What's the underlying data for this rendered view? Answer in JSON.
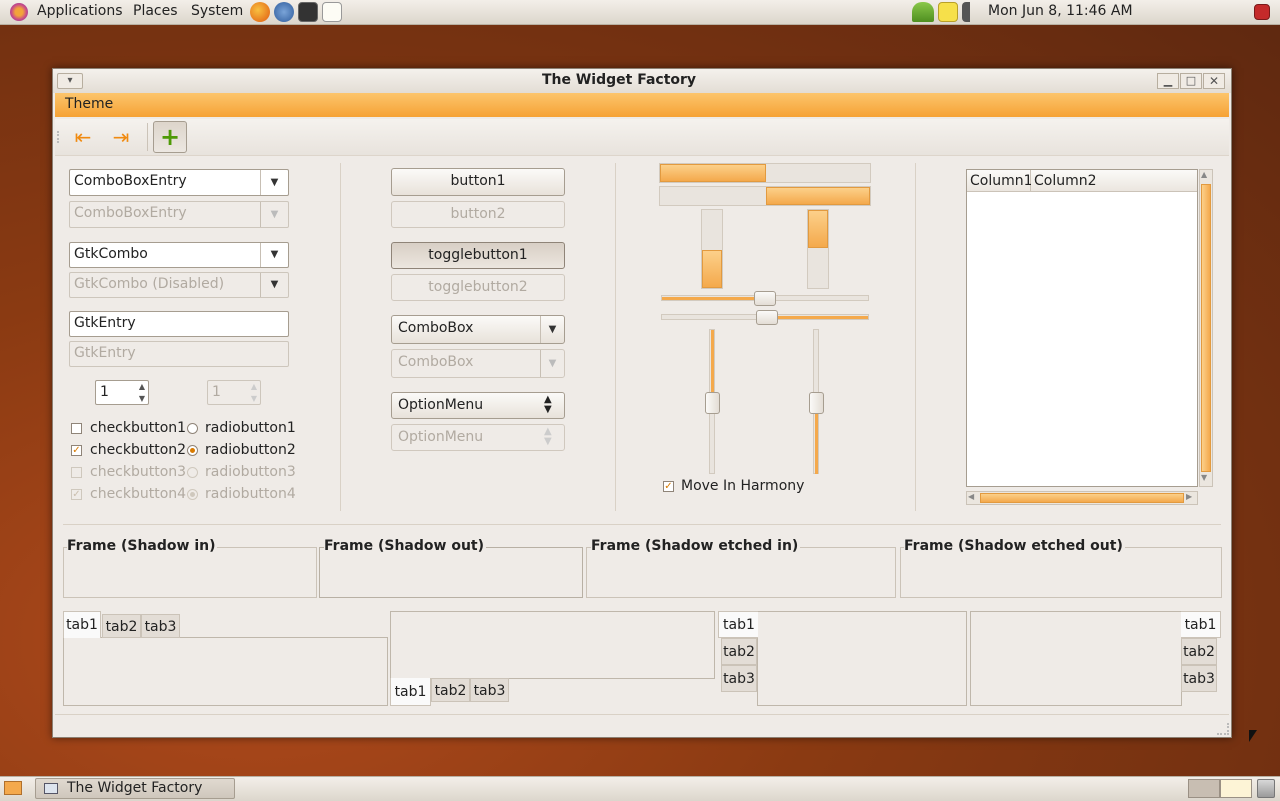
{
  "top_panel": {
    "menus": [
      "Applications",
      "Places",
      "System"
    ],
    "clock": "Mon Jun  8, 11:46 AM"
  },
  "window": {
    "title": "The Widget Factory",
    "menubar": {
      "theme": "Theme"
    }
  },
  "col1": {
    "combo_entry": "ComboBoxEntry",
    "combo_entry_disabled": "ComboBoxEntry",
    "gtk_combo": "GtkCombo",
    "gtk_combo_disabled": "GtkCombo (Disabled)",
    "entry": "GtkEntry",
    "entry_disabled_placeholder": "GtkEntry",
    "spin_value": "1",
    "spin_disabled_value": "1",
    "checks": [
      {
        "label": "checkbutton1",
        "checked": false,
        "disabled": false
      },
      {
        "label": "checkbutton2",
        "checked": true,
        "disabled": false
      },
      {
        "label": "checkbutton3",
        "checked": false,
        "disabled": true
      },
      {
        "label": "checkbutton4",
        "checked": true,
        "disabled": true
      }
    ],
    "radios": [
      {
        "label": "radiobutton1",
        "on": false,
        "disabled": false
      },
      {
        "label": "radiobutton2",
        "on": true,
        "disabled": false
      },
      {
        "label": "radiobutton3",
        "on": false,
        "disabled": true
      },
      {
        "label": "radiobutton4",
        "on": true,
        "disabled": true
      }
    ]
  },
  "col2": {
    "button1": "button1",
    "button2": "button2",
    "toggle1": "togglebutton1",
    "toggle2": "togglebutton2",
    "combobox": "ComboBox",
    "combobox_disabled": "ComboBox",
    "optionmenu": "OptionMenu",
    "optionmenu_disabled": "OptionMenu"
  },
  "col3": {
    "progress_h1": 0.5,
    "progress_h2": 0.5,
    "progress_v1": 0.5,
    "progress_v2": 0.5,
    "scale_h1": 0.5,
    "scale_h2": 0.5,
    "scale_v1": 0.5,
    "scale_v2": 0.5,
    "move_in_harmony": "Move In Harmony"
  },
  "tree": {
    "columns": [
      "Column1",
      "Column2"
    ]
  },
  "frames": [
    "Frame (Shadow in)",
    "Frame (Shadow out)",
    "Frame (Shadow etched in)",
    "Frame (Shadow etched out)"
  ],
  "notebooks": {
    "tabs": [
      "tab1",
      "tab2",
      "tab3"
    ]
  },
  "taskbar": {
    "task": "The Widget Factory"
  },
  "colors": {
    "accent": "#f6a235",
    "check": "#d87a00"
  }
}
